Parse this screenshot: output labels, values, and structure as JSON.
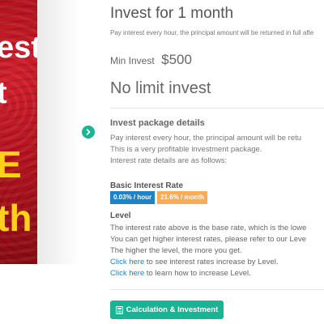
{
  "banner": {
    "line1": "est",
    "line2": "t",
    "line3": "E",
    "line4": "th"
  },
  "colors": {
    "accent_green": "#1ab394",
    "rate_hour_bg": "#1c84c6",
    "rate_month_bg": "#f8ac59",
    "link": "#1c84c6",
    "banner_red": "#b3121d",
    "banner_yellow": "#ffd21a"
  },
  "icons": {
    "nav_next": "chevron-right-icon",
    "calculator": "calculator-icon"
  },
  "package": {
    "title": "Invest for 1 month",
    "subtitle": "Pay interest every hour, the principal amount will be returned in full afte",
    "min_invest_label": "Min Invest",
    "min_invest_value": "$500",
    "limit_text": "No limit invest"
  },
  "details": {
    "heading": "Invest package details",
    "lines": [
      "Pay interest every hour, the principal amount will be retu",
      "This is a very profitable investment package.",
      "Interest rate details are as follows:"
    ]
  },
  "rates": {
    "heading": "Basic Interest Rate",
    "hour": "0.03% / hour",
    "month": "21.6% / month"
  },
  "level": {
    "heading": "Level",
    "lines": [
      "The interest rate above is the base rate, which is the lowe",
      "You can get higher interest rates, please refer to our Leve",
      "The higher the level, the more you get."
    ],
    "link1_text": "Click here",
    "link1_rest": " to see interest rates increase by Level.",
    "link2_text": "Click here",
    "link2_rest": " to learn how to increase Level."
  },
  "button": {
    "label": "Calculation & Investment"
  }
}
